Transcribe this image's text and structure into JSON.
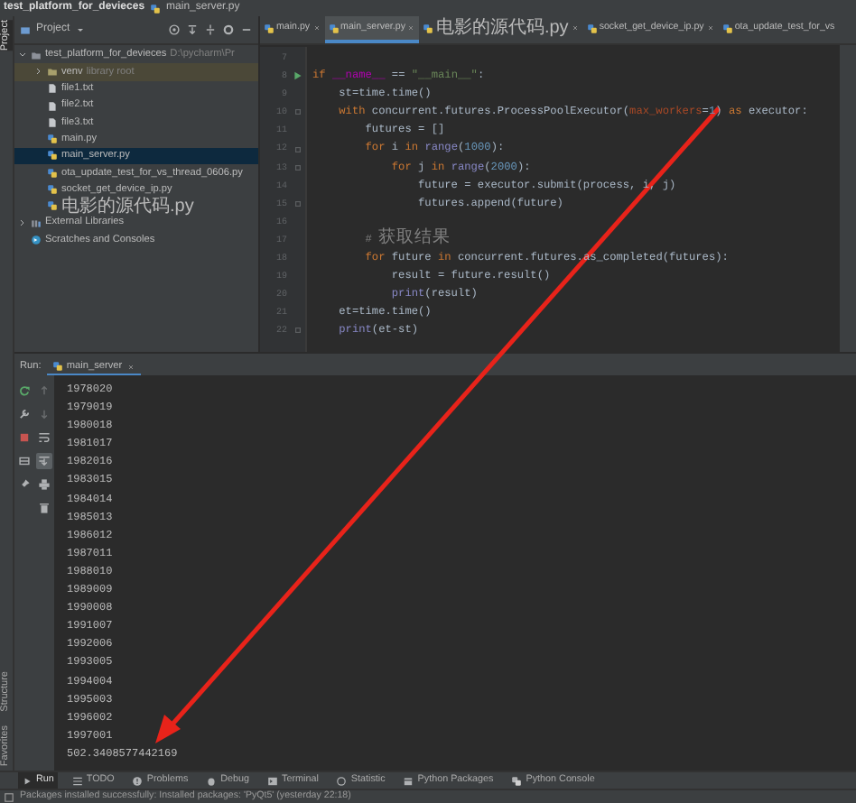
{
  "title_bar": {
    "project": "test_platform_for_devieces",
    "file": "main_server.py"
  },
  "left_stripe": {
    "top": "Project",
    "bottom": [
      "Structure",
      "Favorites"
    ]
  },
  "project_panel": {
    "title": "Project",
    "tree": [
      {
        "label": "test_platform_for_devieces",
        "hint": "D:\\pycharm\\Pr",
        "kind": "folder",
        "expanded": true,
        "selected": false,
        "children": [
          {
            "label": "venv",
            "hint": "library root",
            "kind": "library-folder",
            "expanded": false,
            "selected": false
          },
          {
            "label": "file1.txt",
            "kind": "txt",
            "selected": false
          },
          {
            "label": "file2.txt",
            "kind": "txt",
            "selected": false
          },
          {
            "label": "file3.txt",
            "kind": "txt",
            "selected": false
          },
          {
            "label": "main.py",
            "kind": "py",
            "selected": false
          },
          {
            "label": "main_server.py",
            "kind": "py",
            "selected": true
          },
          {
            "label": "ota_update_test_for_vs_thread_0606.py",
            "kind": "py",
            "selected": false
          },
          {
            "label": "socket_get_device_ip.py",
            "kind": "py",
            "selected": false
          },
          {
            "label": "电影的源代码.py",
            "kind": "py",
            "selected": false
          }
        ]
      },
      {
        "label": "External Libraries",
        "kind": "libraries",
        "expanded": false,
        "selected": false
      },
      {
        "label": "Scratches and Consoles",
        "kind": "scratches",
        "selected": false
      }
    ]
  },
  "editor": {
    "tabs": [
      {
        "label": "main.py",
        "selected": false
      },
      {
        "label": "main_server.py",
        "selected": true
      },
      {
        "label": "电影的源代码.py",
        "selected": false
      },
      {
        "label": "socket_get_device_ip.py",
        "selected": false
      },
      {
        "label": "ota_update_test_for_vs",
        "selected": false
      }
    ],
    "lines": [
      {
        "number": "7"
      },
      {
        "number": "8",
        "kind": "run",
        "tokens": [
          {
            "t": "if ",
            "kind": "kw"
          },
          {
            "t": "__name__",
            "kind": "dunder"
          },
          {
            "t": " == ",
            "kind": "plain"
          },
          {
            "t": "\"__main__\"",
            "kind": "str"
          },
          {
            "t": ":",
            "kind": "plain"
          }
        ]
      },
      {
        "number": "9",
        "tokens": [
          {
            "t": "    st=time.time()",
            "kind": "plain"
          }
        ]
      },
      {
        "number": "10",
        "kind": "fold",
        "tokens": [
          {
            "t": "    with ",
            "kind": "kw"
          },
          {
            "t": "concurrent.futures.ProcessPoolExecutor(",
            "kind": "plain"
          },
          {
            "t": "max_workers",
            "kind": "param"
          },
          {
            "t": "=",
            "kind": "plain"
          },
          {
            "t": "1",
            "kind": "num"
          },
          {
            "t": ") ",
            "kind": "plain"
          },
          {
            "t": "as ",
            "kind": "kw"
          },
          {
            "t": "executor:",
            "kind": "plain"
          }
        ]
      },
      {
        "number": "11",
        "tokens": [
          {
            "t": "        futures = []",
            "kind": "plain"
          }
        ]
      },
      {
        "number": "12",
        "kind": "fold",
        "tokens": [
          {
            "t": "        for ",
            "kind": "kw"
          },
          {
            "t": "i ",
            "kind": "plain"
          },
          {
            "t": "in ",
            "kind": "kw"
          },
          {
            "t": "range",
            "kind": "builtin"
          },
          {
            "t": "(",
            "kind": "plain"
          },
          {
            "t": "1000",
            "kind": "num"
          },
          {
            "t": "):",
            "kind": "plain"
          }
        ]
      },
      {
        "number": "13",
        "kind": "fold",
        "tokens": [
          {
            "t": "            for ",
            "kind": "kw"
          },
          {
            "t": "j ",
            "kind": "plain"
          },
          {
            "t": "in ",
            "kind": "kw"
          },
          {
            "t": "range",
            "kind": "builtin"
          },
          {
            "t": "(",
            "kind": "plain"
          },
          {
            "t": "2000",
            "kind": "num"
          },
          {
            "t": "):",
            "kind": "plain"
          }
        ]
      },
      {
        "number": "14",
        "tokens": [
          {
            "t": "                future = executor.submit(process, i, j)",
            "kind": "plain"
          }
        ]
      },
      {
        "number": "15",
        "kind": "fold",
        "tokens": [
          {
            "t": "                futures.append(future)",
            "kind": "plain"
          }
        ]
      },
      {
        "number": "16"
      },
      {
        "number": "17",
        "tokens": [
          {
            "t": "        # 获取结果",
            "kind": "comment"
          }
        ]
      },
      {
        "number": "18",
        "tokens": [
          {
            "t": "        for ",
            "kind": "kw"
          },
          {
            "t": "future ",
            "kind": "plain"
          },
          {
            "t": "in ",
            "kind": "kw"
          },
          {
            "t": "concurrent.futures.as_completed(futures):",
            "kind": "plain"
          }
        ]
      },
      {
        "number": "19",
        "tokens": [
          {
            "t": "            result = future.result()",
            "kind": "plain"
          }
        ]
      },
      {
        "number": "20",
        "tokens": [
          {
            "t": "            print",
            "kind": "builtin"
          },
          {
            "t": "(result)",
            "kind": "plain"
          }
        ]
      },
      {
        "number": "21",
        "tokens": [
          {
            "t": "    et=time.time()",
            "kind": "plain"
          }
        ]
      },
      {
        "number": "22",
        "kind": "fold",
        "tokens": [
          {
            "t": "    print",
            "kind": "builtin"
          },
          {
            "t": "(et-st)",
            "kind": "plain"
          }
        ]
      }
    ]
  },
  "run": {
    "label": "Run:",
    "tab": "main_server",
    "toolbar": [
      {
        "kind": "rerun"
      },
      {
        "kind": "wrench"
      },
      {
        "kind": "stop"
      },
      {
        "kind": "layout"
      },
      {
        "kind": "pin"
      }
    ],
    "toolbar2": [
      {
        "kind": "up",
        "disabled": true,
        "on": false
      },
      {
        "kind": "down",
        "disabled": true,
        "on": false
      },
      {
        "kind": "wrap",
        "disabled": false,
        "on": false
      },
      {
        "kind": "scrollend",
        "disabled": false,
        "on": true
      },
      {
        "kind": "print",
        "disabled": false,
        "on": false
      },
      {
        "kind": "trash",
        "disabled": false,
        "on": false
      }
    ],
    "output": [
      "1978020",
      "1979019",
      "1980018",
      "1981017",
      "1982016",
      "1983015",
      "1984014",
      "1985013",
      "1986012",
      "1987011",
      "1988010",
      "1989009",
      "1990008",
      "1991007",
      "1992006",
      "1993005",
      "1994004",
      "1995003",
      "1996002",
      "1997001",
      "502.3408577442169"
    ]
  },
  "tool_windows": [
    {
      "label": "Run",
      "kind": "run",
      "selected": true
    },
    {
      "label": "TODO",
      "kind": "todo",
      "selected": false
    },
    {
      "label": "Problems",
      "kind": "problems",
      "selected": false
    },
    {
      "label": "Debug",
      "kind": "debug",
      "selected": false
    },
    {
      "label": "Terminal",
      "kind": "terminal",
      "selected": false
    },
    {
      "label": "Statistic",
      "kind": "statistic",
      "selected": false
    },
    {
      "label": "Python Packages",
      "kind": "packages",
      "selected": false
    },
    {
      "label": "Python Console",
      "kind": "console",
      "selected": false
    }
  ],
  "status_bar": "Packages installed successfully: Installed packages: 'PyQt5' (yesterday 22:18)"
}
